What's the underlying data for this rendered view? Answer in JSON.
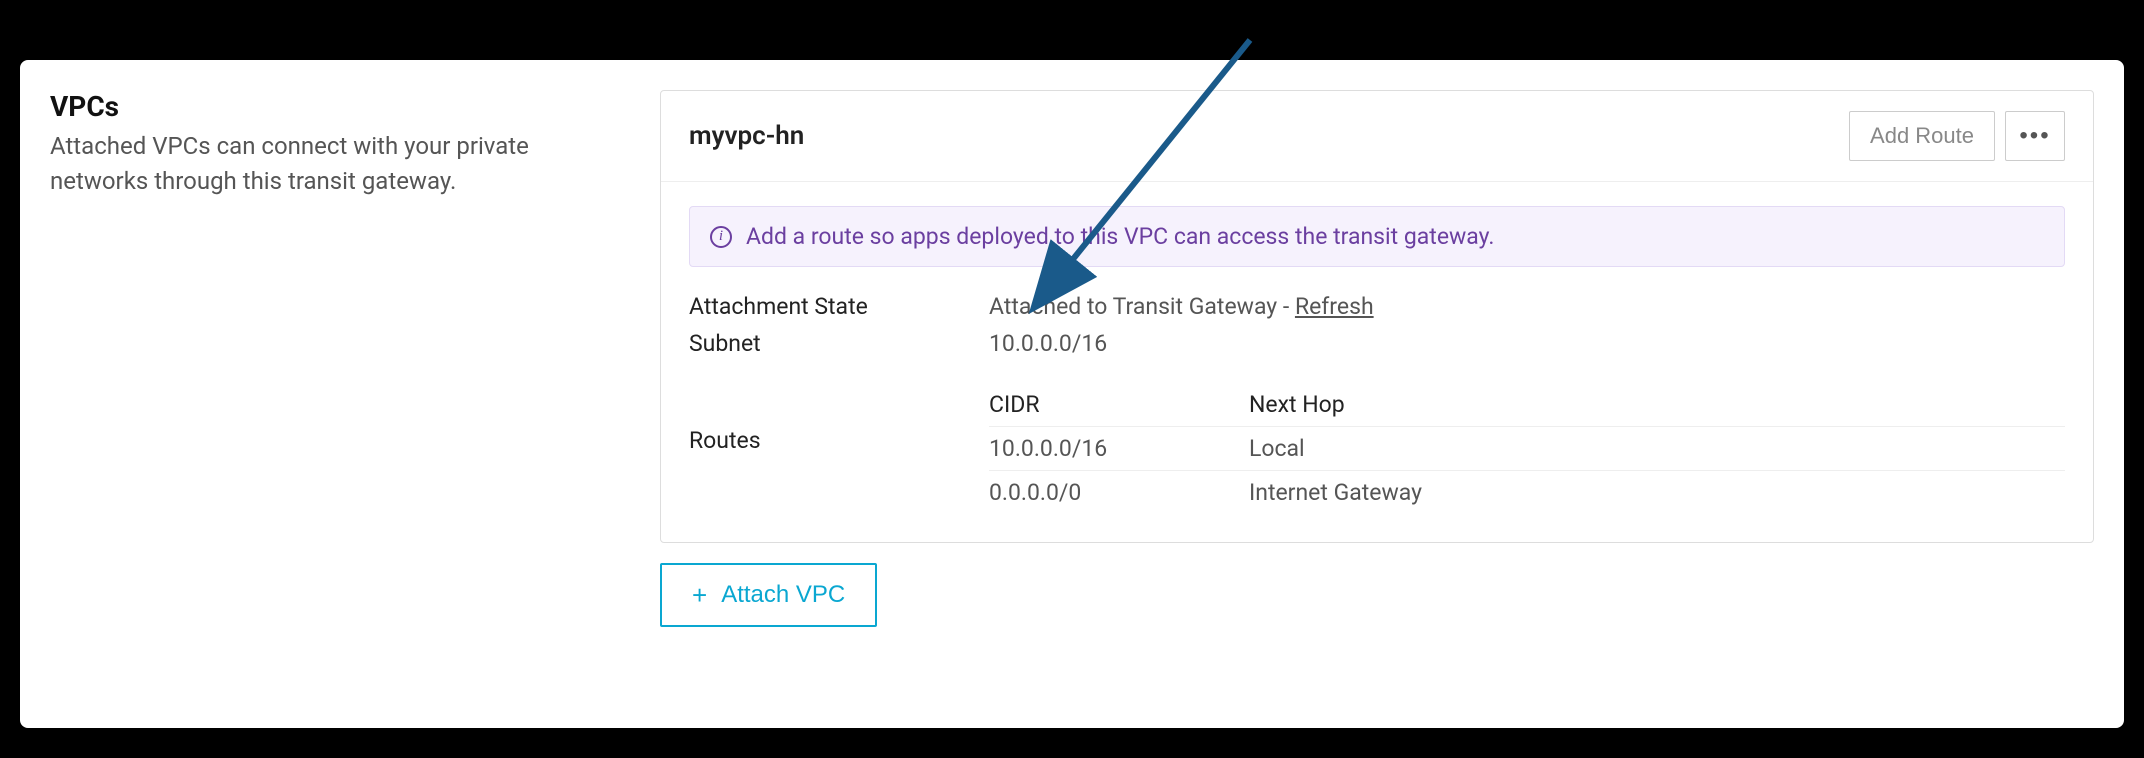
{
  "left": {
    "title": "VPCs",
    "description": "Attached VPCs can connect with your private networks through this transit gateway."
  },
  "card": {
    "title": "myvpc-hn",
    "add_route_label": "Add Route",
    "info_message": "Add a route so apps deployed to this VPC can access the transit gateway.",
    "attachment_state_label": "Attachment State",
    "attachment_state_value": "Attached to Transit Gateway - ",
    "refresh_label": "Refresh",
    "subnet_label": "Subnet",
    "subnet_value": "10.0.0.0/16",
    "routes_label": "Routes",
    "routes_headers": {
      "cidr": "CIDR",
      "next_hop": "Next Hop"
    },
    "routes": [
      {
        "cidr": "10.0.0.0/16",
        "next_hop": "Local"
      },
      {
        "cidr": "0.0.0.0/0",
        "next_hop": "Internet Gateway"
      }
    ]
  },
  "attach_vpc_label": "Attach VPC"
}
